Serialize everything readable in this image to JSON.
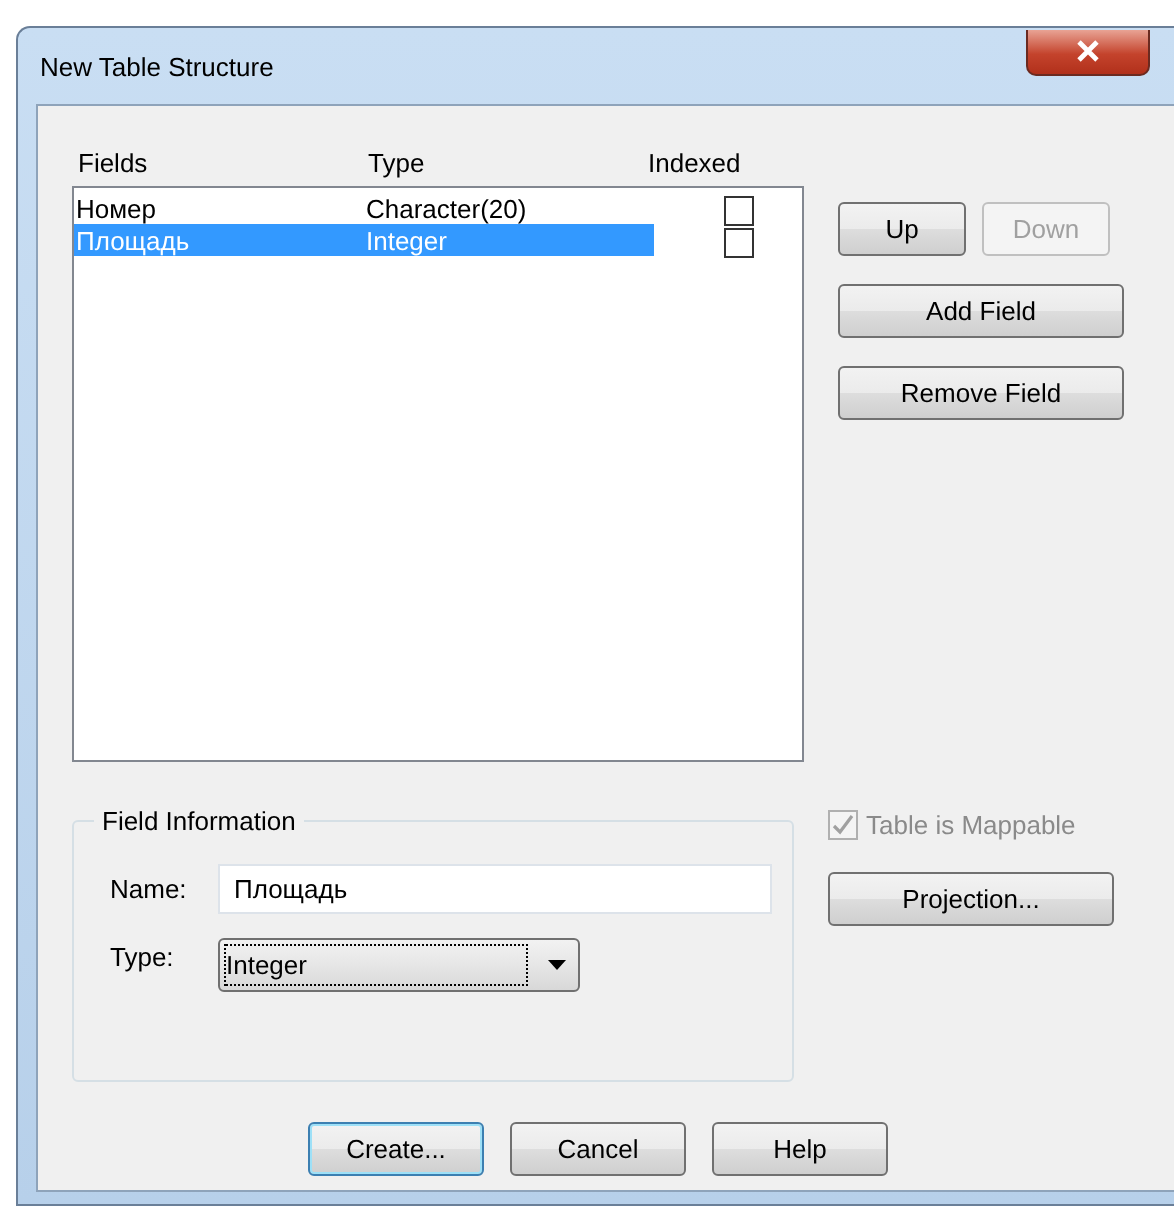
{
  "window": {
    "title": "New Table Structure"
  },
  "fields_list": {
    "columns": [
      "Fields",
      "Type",
      "Indexed"
    ],
    "rows": [
      {
        "name": "Номер",
        "type": "Character(20)",
        "indexed": false,
        "selected": false
      },
      {
        "name": "Площадь",
        "type": "Integer",
        "indexed": false,
        "selected": true
      }
    ]
  },
  "side_button_rows": [
    [
      {
        "label": "Up",
        "disabled": false
      },
      {
        "label": "Down",
        "disabled": true
      }
    ],
    [
      {
        "label": "Add Field",
        "disabled": false
      }
    ],
    [
      {
        "label": "Remove Field",
        "disabled": false
      }
    ]
  ],
  "field_information": {
    "title": "Field Information",
    "name_label": "Name:",
    "name_value": "Площадь",
    "type_label": "Type:",
    "type_value": "Integer"
  },
  "table_is_mappable": {
    "label": "Table is Mappable",
    "checked": true,
    "disabled": true
  },
  "projection_button": {
    "label": "Projection..."
  },
  "buttons": [
    {
      "label": "Create...",
      "default": true
    },
    {
      "label": "Cancel",
      "default": false
    },
    {
      "label": "Help",
      "default": false
    }
  ]
}
